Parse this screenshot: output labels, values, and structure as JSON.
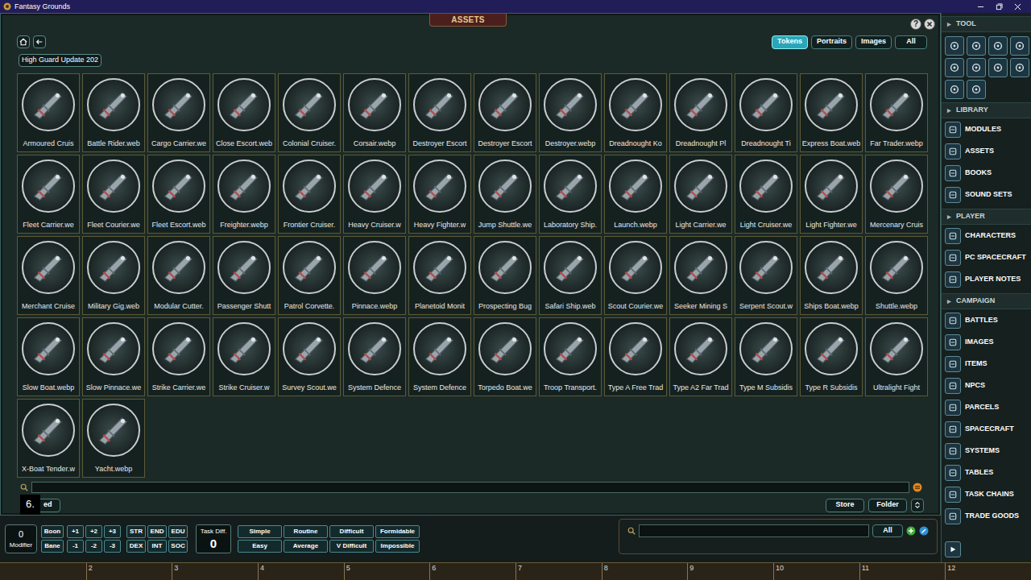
{
  "window": {
    "title": "Fantasy Grounds"
  },
  "assets": {
    "title": "ASSETS",
    "help": "?",
    "breadcrumb": "High Guard Update 202",
    "filters": [
      {
        "label": "Tokens",
        "selected": true
      },
      {
        "label": "Portraits",
        "selected": false
      },
      {
        "label": "Images",
        "selected": false
      },
      {
        "label": "All",
        "selected": false
      }
    ],
    "tokens": [
      "Armoured Cruis",
      "Battle Rider.web",
      "Cargo Carrier.we",
      "Close Escort.web",
      "Colonial Cruiser.",
      "Corsair.webp",
      "Destroyer Escort",
      "Destroyer Escort",
      "Destroyer.webp",
      "Dreadnought Ko",
      "Dreadnought Pl",
      "Dreadnought Ti",
      "Express Boat.web",
      "Far Trader.webp",
      "Fleet Carrier.we",
      "Fleet Courier.we",
      "Fleet Escort.web",
      "Freighter.webp",
      "Frontier Cruiser.",
      "Heavy Cruiser.w",
      "Heavy Fighter.w",
      "Jump Shuttle.we",
      "Laboratory Ship.",
      "Launch.webp",
      "Light Carrier.we",
      "Light Cruiser.we",
      "Light Fighter.we",
      "Mercenary Cruis",
      "Merchant Cruise",
      "Military Gig.web",
      "Modular Cutter.",
      "Passenger Shutt",
      "Patrol Corvette.",
      "Pinnace.webp",
      "Planetoid Monit",
      "Prospecting Bug",
      "Safari Ship.web",
      "Scout Courier.we",
      "Seeker Mining S",
      "Serpent Scout.w",
      "Ships Boat.webp",
      "Shuttle.webp",
      "Slow Boat.webp",
      "Slow Pinnace.we",
      "Strike Carrier.we",
      "Strike Cruiser.w",
      "Survey Scout.we",
      "System Defence",
      "System Defence",
      "Torpedo Boat.we",
      "Troop Transport.",
      "Type A Free Trad",
      "Type A2 Far Trad",
      "Type M Subsidis",
      "Type R Subsidis",
      "Ultralight Fight",
      "X-Boat Tender.w",
      "Yacht.webp"
    ],
    "footer": {
      "badge": "6.",
      "left_button": "ed",
      "buttons": [
        "Store",
        "Folder"
      ]
    }
  },
  "sidebar": {
    "tool_title": "TOOL",
    "sections": [
      {
        "title": "LIBRARY",
        "items": [
          "MODULES",
          "ASSETS",
          "BOOKS",
          "SOUND SETS"
        ]
      },
      {
        "title": "PLAYER",
        "items": [
          "CHARACTERS",
          "PC SPACECRAFT",
          "PLAYER NOTES"
        ]
      },
      {
        "title": "CAMPAIGN",
        "items": [
          "BATTLES",
          "IMAGES",
          "ITEMS",
          "NPCS",
          "PARCELS",
          "SPACECRAFT",
          "SYSTEMS",
          "TABLES",
          "TASK CHAINS",
          "TRADE GOODS"
        ]
      }
    ]
  },
  "dice": {
    "modifier": {
      "value": "0",
      "label": "Modifier"
    },
    "boon": "Boon",
    "bane": "Bane",
    "plus": [
      "+1",
      "+2",
      "+3"
    ],
    "minus": [
      "-1",
      "-2",
      "-3"
    ],
    "stats": [
      [
        "STR",
        "END",
        "EDU"
      ],
      [
        "DEX",
        "INT",
        "SOC"
      ]
    ],
    "task": {
      "label": "Task Diff.",
      "value": "0"
    },
    "difficulties": [
      [
        "Simple",
        "Routine",
        "Difficult",
        "Formidable"
      ],
      [
        "Easy",
        "Average",
        "V Difficult",
        "Impossible"
      ]
    ]
  },
  "chat": {
    "filter": "All"
  },
  "ruler": [
    "2",
    "3",
    "4",
    "5",
    "6",
    "7",
    "8",
    "9",
    "10",
    "11",
    "12"
  ]
}
